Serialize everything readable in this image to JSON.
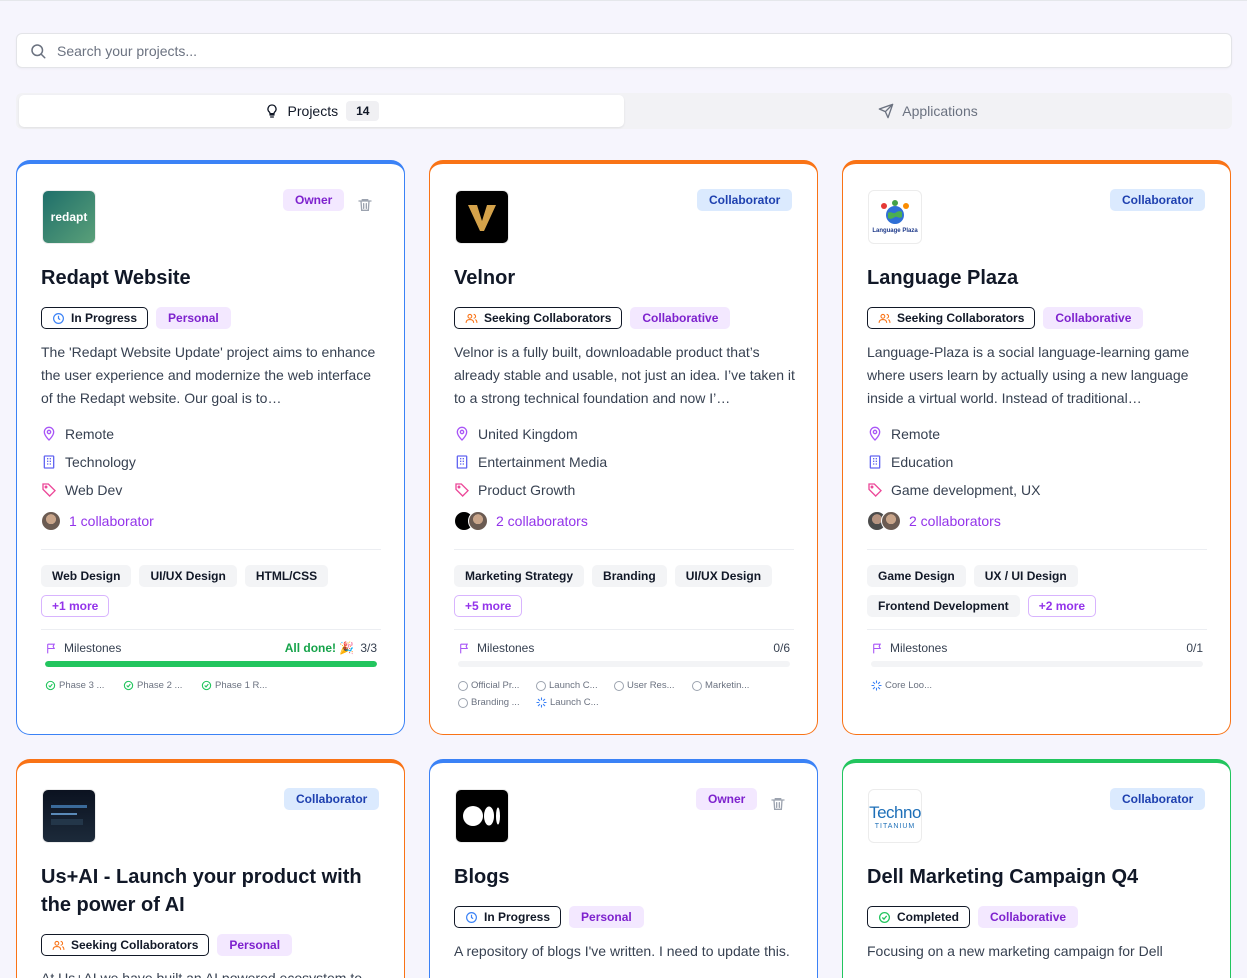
{
  "search": {
    "placeholder": "Search your projects..."
  },
  "tabs": {
    "projects": {
      "label": "Projects",
      "count": "14"
    },
    "applications": {
      "label": "Applications"
    }
  },
  "labels": {
    "milestones": "Milestones",
    "all_done": "All done! 🎉"
  },
  "cards": [
    {
      "title": "Redapt Website",
      "role": "Owner",
      "logo_text": "redapt",
      "status": "In Progress",
      "type": "Personal",
      "description": "The 'Redapt Website Update' project aims to enhance the user experience and modernize the web interface of the Redapt website. Our goal is to…",
      "location": "Remote",
      "industry": "Technology",
      "tags": "Web Dev",
      "collaborators": "1 collaborator",
      "skills": [
        "Web Design",
        "UI/UX Design",
        "HTML/CSS"
      ],
      "more": "+1 more",
      "milestones_count": "3/3",
      "milestones_progress": 1.0,
      "milestone_items": [
        "Phase 3 ...",
        "Phase 2 ...",
        "Phase 1 R..."
      ]
    },
    {
      "title": "Velnor",
      "role": "Collaborator",
      "status": "Seeking Collaborators",
      "type": "Collaborative",
      "description": "Velnor is a fully built, downloadable product that’s already stable and usable, not just an idea. I’ve taken it to a strong technical foundation and now I’…",
      "location": "United Kingdom",
      "industry": "Entertainment Media",
      "tags": "Product Growth",
      "collaborators": "2 collaborators",
      "skills": [
        "Marketing Strategy",
        "Branding",
        "UI/UX Design"
      ],
      "more": "+5 more",
      "milestones_count": "0/6",
      "milestones_progress": 0,
      "milestone_items": [
        "Official Pr...",
        "Launch C...",
        "User Res...",
        "Marketin...",
        "Branding ...",
        "Launch C..."
      ]
    },
    {
      "title": "Language Plaza",
      "role": "Collaborator",
      "logo_text": "Language Plaza",
      "status": "Seeking Collaborators",
      "type": "Collaborative",
      "description": "Language-Plaza is a social language-learning game where users learn by actually using a new language inside a virtual world. Instead of traditional…",
      "location": "Remote",
      "industry": "Education",
      "tags": "Game development, UX",
      "collaborators": "2 collaborators",
      "skills": [
        "Game Design",
        "UX / UI Design",
        "Frontend Development"
      ],
      "more": "+2 more",
      "milestones_count": "0/1",
      "milestones_progress": 0,
      "milestone_items": [
        "Core Loo..."
      ]
    },
    {
      "title": "Us+AI - Launch your product with the power of AI",
      "role": "Collaborator",
      "status": "Seeking Collaborators",
      "type": "Personal",
      "description": "At Us+AI we have built an AI powered ecosystem to"
    },
    {
      "title": "Blogs",
      "role": "Owner",
      "status": "In Progress",
      "type": "Personal",
      "description": "A repository of blogs I've written. I need to update this."
    },
    {
      "title": "Dell Marketing Campaign Q4",
      "role": "Collaborator",
      "logo_text": "Techno",
      "logo_subtext": "TITANIUM",
      "status": "Completed",
      "type": "Collaborative",
      "description": "Focusing on a new marketing campaign for Dell"
    }
  ],
  "colors": {
    "owner_border": "#3b82f6",
    "collab_border": "#f97316",
    "completed_border": "#22c55e",
    "progress_fill": "#22c55e",
    "accent": "#9333ea"
  }
}
